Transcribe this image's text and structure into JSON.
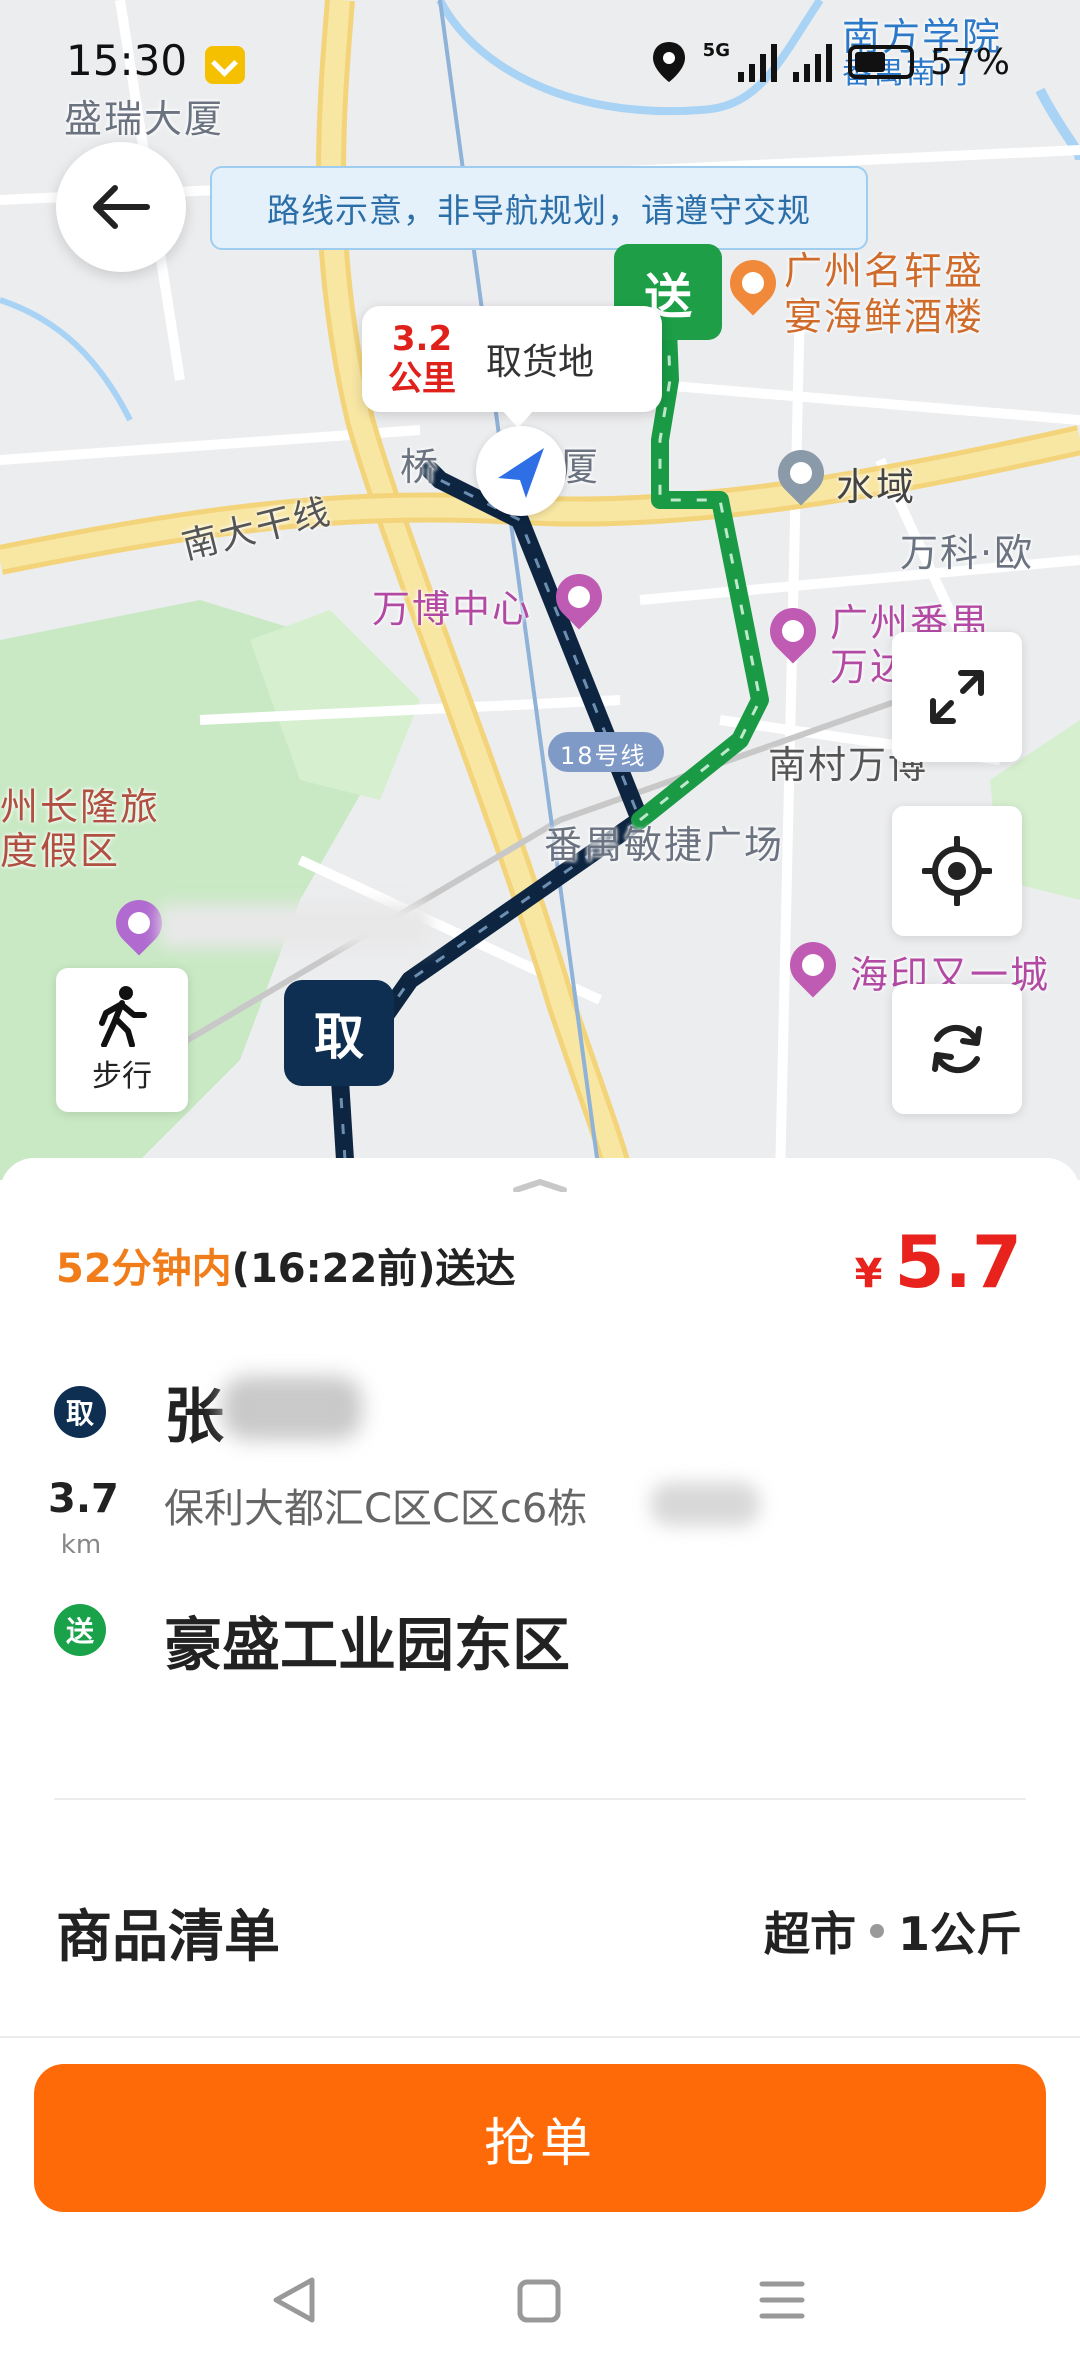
{
  "status_bar": {
    "time": "15:30",
    "network": "5G",
    "battery": "57%"
  },
  "map": {
    "notice": "路线示意，非导航规划，请遵守交规",
    "distance_value": "3.2",
    "distance_unit": "公里",
    "pickup_bubble_label": "取货地",
    "pickup_marker": "取",
    "drop_marker": "送",
    "walk_label": "步行",
    "labels": {
      "shengrui": "盛瑞大厦",
      "nanfang": "南方学院",
      "nanfang2": "番禺南门",
      "mingxuan": "广州名轩盛",
      "mingxuan2": "宴海鲜酒楼",
      "shuiyu": "水域",
      "wanke": "万科·欧",
      "qiao": "桥",
      "qiao2": "厦",
      "nanda": "南大干线",
      "wanbo": "万博中心",
      "panyu": "广州番禺",
      "panyu2": "万达",
      "nancun": "南村万博",
      "line18": "18号线",
      "minjie": "番禺敏捷广场",
      "changlong": "州长隆旅",
      "changlong2": "度假区",
      "haiyin": "海印又一城"
    }
  },
  "order": {
    "eta_highlight": "52分钟内",
    "eta_rest": "(16:22前)送达",
    "price_symbol": "¥",
    "price": "5.7",
    "pickup_badge": "取",
    "pickup_name": "张",
    "distance": "3.7",
    "distance_unit": "km",
    "pickup_address": "保利大都汇C区C区c6栋",
    "drop_badge": "送",
    "drop_name": "豪盛工业园东区",
    "goods_title": "商品清单",
    "goods_category": "超市",
    "goods_weight": "1公斤",
    "grab_button": "抢单"
  }
}
